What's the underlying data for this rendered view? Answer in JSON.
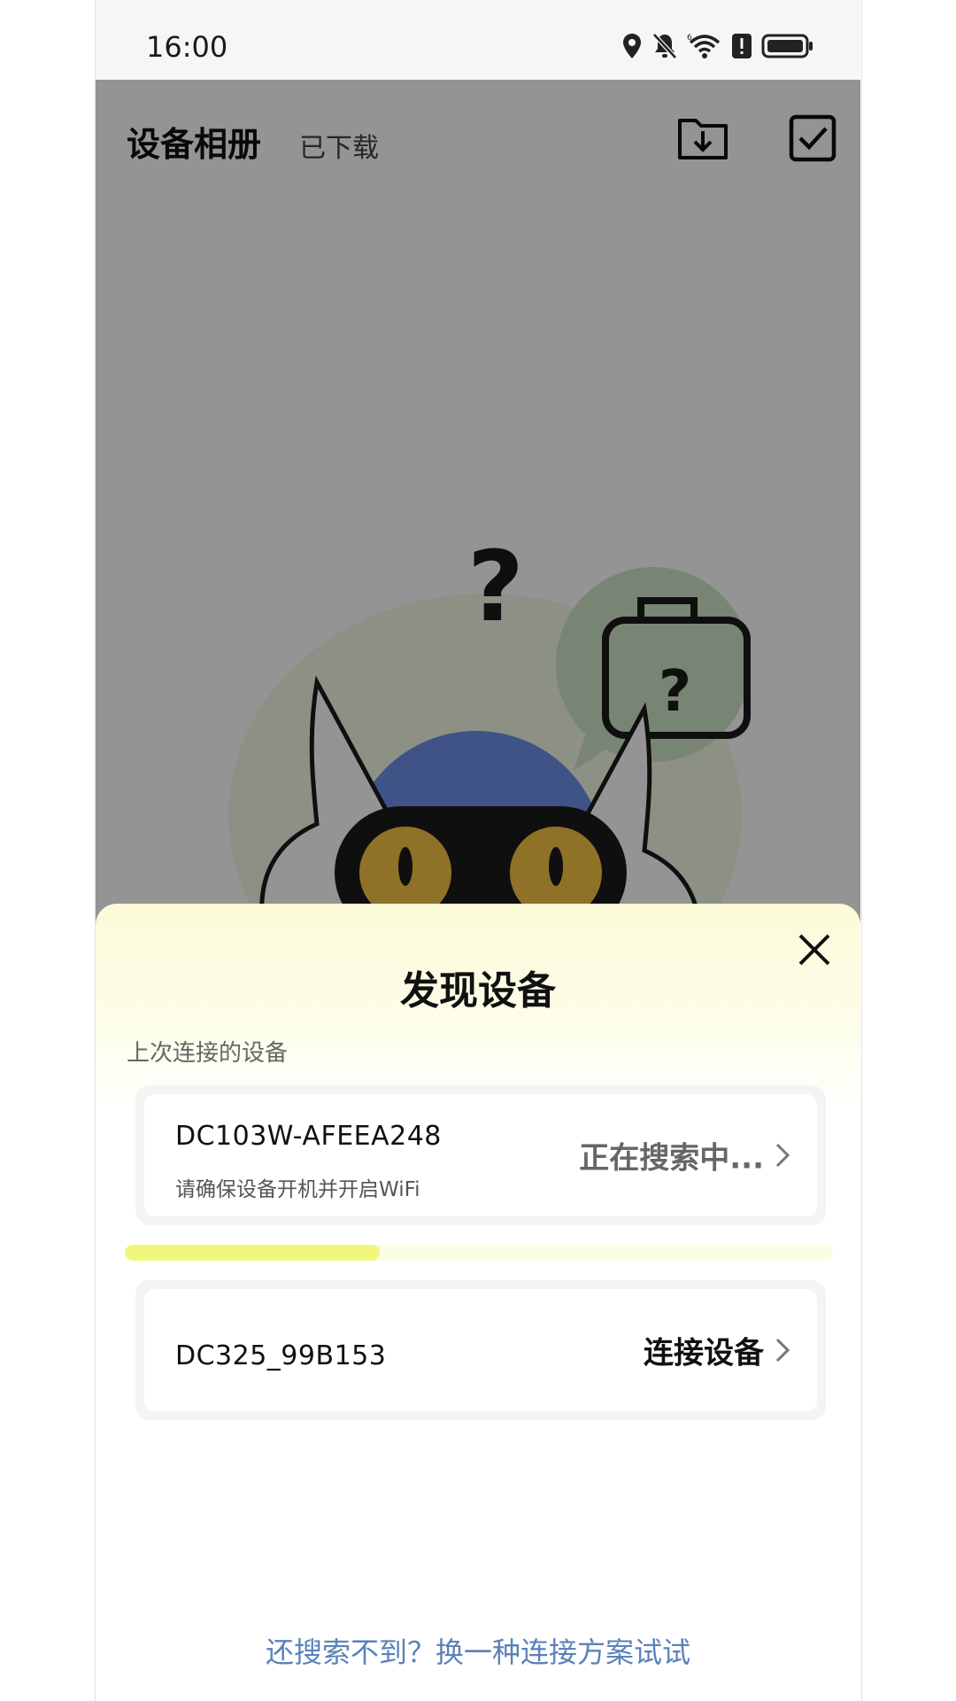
{
  "status_bar": {
    "time": "16:00",
    "icons": [
      "location-icon",
      "bell-muted-icon",
      "wifi-6-icon",
      "alert-icon",
      "battery-icon"
    ]
  },
  "header": {
    "title": "设备相册",
    "tab_downloaded": "已下载",
    "icons": [
      "folder-download-icon",
      "checkbox-icon"
    ]
  },
  "sheet": {
    "title": "发现设备",
    "section_label": "上次连接的设备",
    "devices": [
      {
        "name": "DC103W-AFEEA248",
        "hint": "请确保设备开机并开启WiFi",
        "action": "正在搜索中..."
      },
      {
        "name": "DC325_99B153",
        "action": "连接设备"
      }
    ],
    "search_progress": 0.36,
    "alt_link": "还搜索不到？换一种连接方案试试"
  },
  "colors": {
    "accent_yellow": "#f1f77c",
    "link_blue": "#5b82b8",
    "sheet_gradient_top": "#fbfbd8"
  }
}
